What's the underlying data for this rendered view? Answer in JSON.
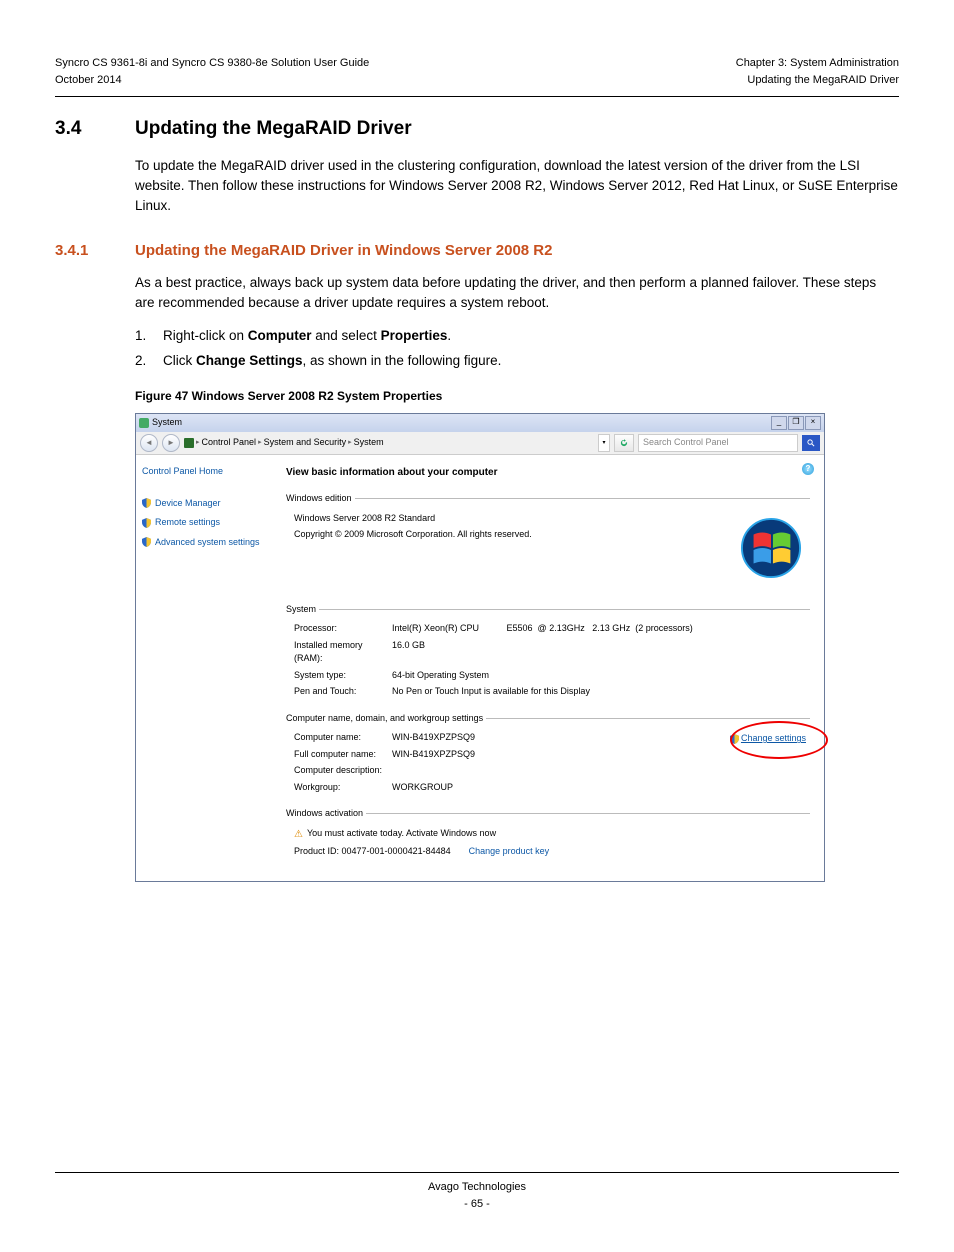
{
  "header": {
    "left_line1": "Syncro CS 9361-8i and Syncro CS 9380-8e Solution User Guide",
    "left_line2": "October 2014",
    "right_line1": "Chapter 3: System Administration",
    "right_line2": "Updating the MegaRAID Driver"
  },
  "section": {
    "number": "3.4",
    "title": "Updating the MegaRAID Driver",
    "intro": "To update the MegaRAID driver used in the clustering configuration, download the latest version of the driver from the LSI website. Then follow these instructions for Windows Server 2008 R2, Windows Server 2012, Red Hat Linux, or SuSE Enterprise Linux."
  },
  "subsection": {
    "number": "3.4.1",
    "title": "Updating the MegaRAID Driver in Windows Server 2008 R2",
    "intro": "As a best practice, always back up system data before updating the driver, and then perform a planned failover. These steps are recommended because a driver update requires a system reboot.",
    "steps": [
      {
        "n": "1.",
        "pre": "Right-click on ",
        "b1": "Computer",
        "mid": " and select ",
        "b2": "Properties",
        "post": "."
      },
      {
        "n": "2.",
        "pre": "Click ",
        "b1": "Change Settings",
        "mid": ", as shown in the following figure.",
        "b2": "",
        "post": ""
      }
    ]
  },
  "figure": {
    "caption": "Figure 47  Windows Server 2008 R2 System Properties"
  },
  "win": {
    "title": "System",
    "breadcrumb": {
      "root": "Control Panel",
      "mid": "System and Security",
      "leaf": "System"
    },
    "search_placeholder": "Search Control Panel",
    "sidebar": {
      "home": "Control Panel Home",
      "items": [
        "Device Manager",
        "Remote settings",
        "Advanced system settings"
      ]
    },
    "main_title": "View basic information about your computer",
    "edition": {
      "legend": "Windows edition",
      "name": "Windows Server 2008 R2 Standard",
      "copyright": "Copyright © 2009 Microsoft Corporation.  All rights reserved."
    },
    "system": {
      "legend": "System",
      "rows": [
        {
          "label": "Processor:",
          "value": "Intel(R) Xeon(R) CPU           E5506  @ 2.13GHz   2.13 GHz  (2 processors)"
        },
        {
          "label": "Installed memory (RAM):",
          "value": "16.0 GB"
        },
        {
          "label": "System type:",
          "value": "64-bit Operating System"
        },
        {
          "label": "Pen and Touch:",
          "value": "No Pen or Touch Input is available for this Display"
        }
      ]
    },
    "computer": {
      "legend": "Computer name, domain, and workgroup settings",
      "rows": [
        {
          "label": "Computer name:",
          "value": "WIN-B419XPZPSQ9"
        },
        {
          "label": "Full computer name:",
          "value": "WIN-B419XPZPSQ9"
        },
        {
          "label": "Computer description:",
          "value": ""
        },
        {
          "label": "Workgroup:",
          "value": "WORKGROUP"
        }
      ],
      "change_link": "Change settings"
    },
    "activation": {
      "legend": "Windows activation",
      "warn": "You must activate today.  Activate Windows now",
      "product_id_label": "Product ID:  00477-001-0000421-84484",
      "change_key": "Change product key"
    }
  },
  "footer": {
    "company": "Avago Technologies",
    "page": "- 65 -"
  }
}
